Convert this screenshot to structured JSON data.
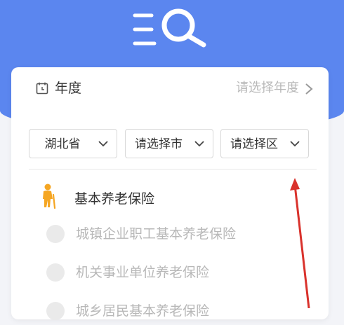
{
  "header": {
    "logo_icon": "list-search-icon",
    "colors": {
      "primary": "#5b86ef",
      "accent_orange": "#f5a623",
      "annotation_red": "#d9322c"
    }
  },
  "filter": {
    "year_label": "年度",
    "year_placeholder": "请选择年度",
    "province": "湖北省",
    "city_placeholder": "请选择市",
    "district_placeholder": "请选择区"
  },
  "pension": {
    "section_title": "基本养老保险",
    "options": [
      {
        "label": "城镇企业职工基本养老保险"
      },
      {
        "label": "机关事业单位养老保险"
      },
      {
        "label": "城乡居民基本养老保险"
      }
    ]
  }
}
